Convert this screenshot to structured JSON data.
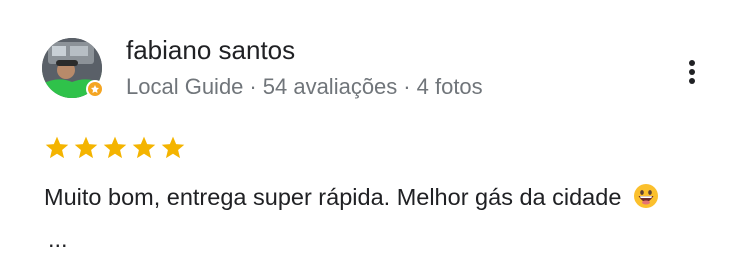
{
  "review": {
    "reviewer": {
      "name": "fabiano santos",
      "badge": "Local Guide",
      "separator": "·",
      "reviews_count_label": "54 avaliações",
      "photos_count_label": "4 fotos",
      "avatar_icon": "avatar",
      "badge_icon": "local-guide-badge-icon"
    },
    "rating": {
      "value": 5,
      "max": 5,
      "star_color": "#f4b400"
    },
    "text": "Muito bom, entrega super rápida. Melhor gás da cidade",
    "emoji": "grinning-face-emoji",
    "truncation": "...",
    "more_icon": "more-vert-icon"
  }
}
